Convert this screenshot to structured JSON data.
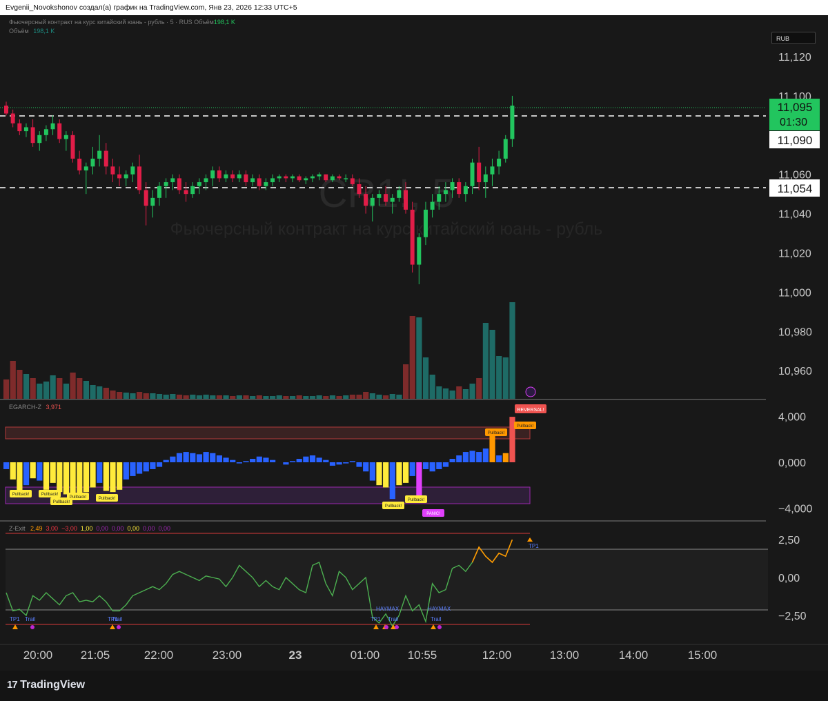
{
  "header": {
    "attribution": "Evgenii_Novokshonov создал(а) график на TradingView.com, Янв 23, 2026 12:33 UTC+5"
  },
  "legend": {
    "symbol_line": "Фьючерсный контракт на курс китайский юань - рубль · 5 · RUS",
    "volume_label": "Объём",
    "volume_value": "198,1 K",
    "volume_line_label": "Объём",
    "volume_line_value": "198,1 K"
  },
  "watermark": {
    "ticker": "CR1!, 5",
    "name": "Фьючерсный контракт на курс китайский юань - рубль"
  },
  "currency_badge": "RUB",
  "price_scale": {
    "ticks": [
      "11,120",
      "11,100",
      "11,060",
      "11,040",
      "11,020",
      "11,000",
      "10,980",
      "10,960"
    ],
    "current_price": "11,095",
    "countdown": "01:30",
    "line_1_price": "11,090",
    "line_2_price": "11,054"
  },
  "egarch": {
    "name": "EGARCH-Z",
    "value": "3,971",
    "ticks": [
      "4,000",
      "0,000",
      "−4,000"
    ],
    "labels": {
      "pullback": "Pullback!",
      "panic": "PANIC!",
      "reversal": "REVERSAL!"
    }
  },
  "zexit": {
    "name": "Z-Exit",
    "values": [
      "2,49",
      "3,00",
      "−3,00",
      "1,00",
      "0,00",
      "0,00",
      "0,00",
      "0,00",
      "0,00"
    ],
    "value_colors": [
      "#ff9800",
      "#f23645",
      "#f23645",
      "#ffeb3b",
      "#9c27b0",
      "#9c27b0",
      "#ffeb3b",
      "#9c27b0",
      "#9c27b0"
    ],
    "ticks": [
      "2,50",
      "0,00",
      "−2,50"
    ],
    "labels": {
      "tp1": "TP1",
      "trail": "Trail",
      "haymax": "HAYMAX"
    }
  },
  "time_axis": [
    "20:00",
    "21:05",
    "22:00",
    "23:00",
    "23",
    "01:00",
    "10:55",
    "12:00",
    "13:00",
    "14:00",
    "15:00"
  ],
  "footer": {
    "logo": "TradingView"
  },
  "colors": {
    "up": "#22c55e",
    "down": "#e11d48",
    "vol_up": "#1e6b66",
    "vol_down": "#7f2b2b",
    "egarch_blue": "#2962ff",
    "pullback": "#ffeb3b",
    "panic": "#e040fb",
    "zexit_line": "#4caf50",
    "zexit_orange": "#ff9800"
  },
  "chart_data": {
    "type": "line",
    "note_series": [
      {
        "name": "Фьючерсный контракт на курс китайский юань - рубль · 5 · RUS",
        "ohlc": [
          [
            11.095,
            11.097,
            11.09,
            11.091
          ],
          [
            11.091,
            11.093,
            11.084,
            11.086
          ],
          [
            11.086,
            11.088,
            11.08,
            11.082
          ],
          [
            11.082,
            11.086,
            11.079,
            11.084
          ],
          [
            11.084,
            11.088,
            11.074,
            11.076
          ],
          [
            11.076,
            11.082,
            11.072,
            11.08
          ],
          [
            11.08,
            11.085,
            11.077,
            11.083
          ],
          [
            11.083,
            11.09,
            11.08,
            11.086
          ],
          [
            11.086,
            11.088,
            11.076,
            11.078
          ],
          [
            11.078,
            11.082,
            11.072,
            11.08
          ],
          [
            11.08,
            11.082,
            11.066,
            11.068
          ],
          [
            11.068,
            11.072,
            11.06,
            11.062
          ],
          [
            11.062,
            11.066,
            11.05,
            11.064
          ],
          [
            11.064,
            11.074,
            11.06,
            11.068
          ],
          [
            11.068,
            11.08,
            11.064,
            11.072
          ],
          [
            11.072,
            11.076,
            11.06,
            11.064
          ],
          [
            11.064,
            11.068,
            11.056,
            11.06
          ],
          [
            11.06,
            11.064,
            11.054,
            11.058
          ],
          [
            11.058,
            11.062,
            11.054,
            11.06
          ],
          [
            11.06,
            11.066,
            11.056,
            11.064
          ],
          [
            11.064,
            11.07,
            11.05,
            11.052
          ],
          [
            11.052,
            11.056,
            11.034,
            11.044
          ],
          [
            11.044,
            11.052,
            11.038,
            11.048
          ],
          [
            11.048,
            11.056,
            11.044,
            11.054
          ],
          [
            11.054,
            11.058,
            11.048,
            11.056
          ],
          [
            11.056,
            11.06,
            11.052,
            11.058
          ],
          [
            11.058,
            11.06,
            11.05,
            11.052
          ],
          [
            11.052,
            11.056,
            11.046,
            11.05
          ],
          [
            11.05,
            11.056,
            11.048,
            11.054
          ],
          [
            11.054,
            11.058,
            11.05,
            11.056
          ],
          [
            11.056,
            11.06,
            11.052,
            11.058
          ],
          [
            11.058,
            11.064,
            11.054,
            11.062
          ],
          [
            11.062,
            11.064,
            11.056,
            11.058
          ],
          [
            11.058,
            11.062,
            11.056,
            11.06
          ],
          [
            11.06,
            11.062,
            11.056,
            11.058
          ],
          [
            11.058,
            11.062,
            11.056,
            11.06
          ],
          [
            11.06,
            11.062,
            11.054,
            11.056
          ],
          [
            11.056,
            11.06,
            11.054,
            11.058
          ],
          [
            11.058,
            11.06,
            11.052,
            11.054
          ],
          [
            11.054,
            11.058,
            11.052,
            11.056
          ],
          [
            11.056,
            11.06,
            11.054,
            11.058
          ],
          [
            11.058,
            11.06,
            11.056,
            11.059
          ],
          [
            11.059,
            11.06,
            11.056,
            11.058
          ],
          [
            11.058,
            11.06,
            11.056,
            11.059
          ],
          [
            11.059,
            11.06,
            11.056,
            11.057
          ],
          [
            11.057,
            11.059,
            11.055,
            11.058
          ],
          [
            11.058,
            11.06,
            11.056,
            11.059
          ],
          [
            11.059,
            11.061,
            11.057,
            11.06
          ],
          [
            11.06,
            11.06,
            11.056,
            11.057
          ],
          [
            11.057,
            11.06,
            11.056,
            11.059
          ],
          [
            11.059,
            11.06,
            11.057,
            11.058
          ],
          [
            11.058,
            11.06,
            11.056,
            11.058
          ],
          [
            11.058,
            11.06,
            11.054,
            11.055
          ],
          [
            11.055,
            11.058,
            11.048,
            11.05
          ],
          [
            11.05,
            11.054,
            11.04,
            11.044
          ],
          [
            11.044,
            11.05,
            11.036,
            11.048
          ],
          [
            11.048,
            11.052,
            11.044,
            11.05
          ],
          [
            11.05,
            11.054,
            11.044,
            11.046
          ],
          [
            11.046,
            11.05,
            11.04,
            11.048
          ],
          [
            11.048,
            11.054,
            11.046,
            11.052
          ],
          [
            11.052,
            11.056,
            11.04,
            11.042
          ],
          [
            11.042,
            11.046,
            11.01,
            11.014
          ],
          [
            11.014,
            11.03,
            11.004,
            11.028
          ],
          [
            11.028,
            11.046,
            11.024,
            11.042
          ],
          [
            11.042,
            11.05,
            11.038,
            11.046
          ],
          [
            11.046,
            11.054,
            11.042,
            11.05
          ],
          [
            11.05,
            11.056,
            11.046,
            11.052
          ],
          [
            11.052,
            11.058,
            11.048,
            11.056
          ],
          [
            11.056,
            11.058,
            11.048,
            11.05
          ],
          [
            11.05,
            11.056,
            11.046,
            11.054
          ],
          [
            11.054,
            11.068,
            11.05,
            11.066
          ],
          [
            11.066,
            11.074,
            11.052,
            11.056
          ],
          [
            11.056,
            11.064,
            11.048,
            11.06
          ],
          [
            11.06,
            11.068,
            11.054,
            11.064
          ],
          [
            11.064,
            11.072,
            11.06,
            11.068
          ],
          [
            11.068,
            11.08,
            11.066,
            11.078
          ],
          [
            11.078,
            11.1,
            11.074,
            11.095
          ]
        ]
      }
    ]
  }
}
